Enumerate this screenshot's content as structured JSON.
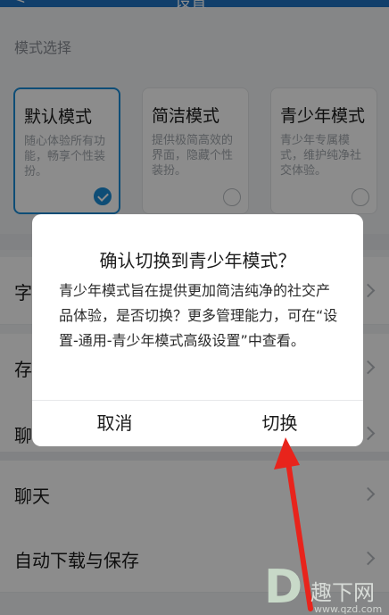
{
  "header": {
    "left_glyph": "<",
    "title": "设置"
  },
  "mode_section": {
    "label": "模式选择",
    "cards": [
      {
        "title": "默认模式",
        "desc": "随心体验所有功能，畅享个性装扮。",
        "selected": true
      },
      {
        "title": "简洁模式",
        "desc": "提供极简高效的界面，隐藏个性装扮。",
        "selected": false
      },
      {
        "title": "青少年模式",
        "desc": "青少年专属模式，维护纯净社交体验。",
        "selected": false
      }
    ]
  },
  "rows": [
    {
      "label": "字"
    },
    {
      "label": "存"
    },
    {
      "label": "聊"
    },
    {
      "label": "聊天"
    },
    {
      "label": "自动下载与保存"
    }
  ],
  "dialog": {
    "title": "确认切换到青少年模式？",
    "message": "青少年模式旨在提供更加简洁纯净的社交产品体验，是否切换？更多管理能力，可在“设置-通用-青少年模式高级设置”中查看。",
    "cancel_label": "取消",
    "confirm_label": "切换"
  },
  "colors": {
    "accent": "#1a8cd8",
    "arrow": "#e8241c",
    "overlay": "rgba(0,0,0,0.45)"
  },
  "watermark": {
    "brand": "趣下网",
    "url": "www.qzd.com"
  }
}
